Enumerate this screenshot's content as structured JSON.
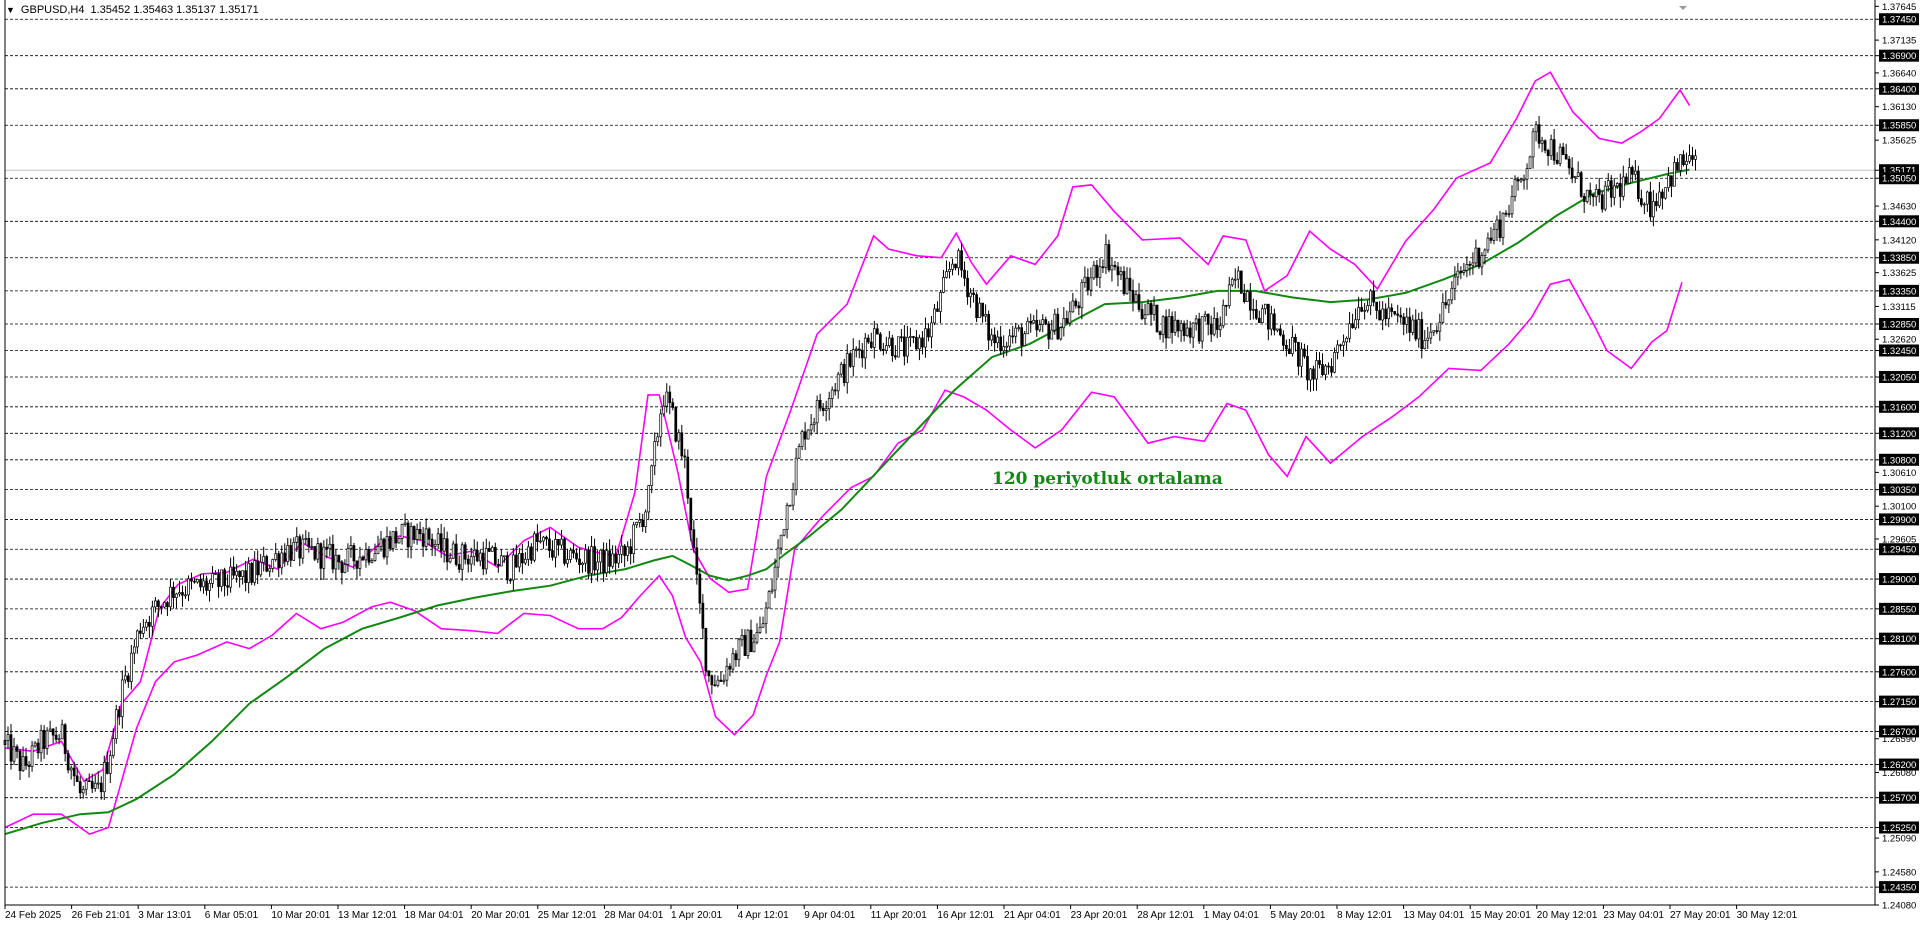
{
  "header": {
    "symbol_timeframe": "GBPUSD,H4",
    "ohlc": "1.35452 1.35463 1.35137 1.35171"
  },
  "colors": {
    "candles": "#000000",
    "bollinger": "#ff00ff",
    "moving_average": "#118811",
    "grid": "#000000",
    "current_price_line": "#c0c0c0"
  },
  "annotation": {
    "text": "120 periyotluk ortalama"
  },
  "chart_data": {
    "type": "candlestick",
    "title": "GBPUSD,H4",
    "ylim": [
      1.2408,
      1.3768
    ],
    "current_price": 1.35171,
    "y_ticks": [
      "1.37645",
      "1.37450",
      "1.37135",
      "1.36900",
      "1.36640",
      "1.36400",
      "1.36130",
      "1.35850",
      "1.35625",
      "1.35171",
      "1.35050",
      "1.34630",
      "1.34400",
      "1.34120",
      "1.33850",
      "1.33625",
      "1.33350",
      "1.33115",
      "1.32850",
      "1.32620",
      "1.32450",
      "1.32050",
      "1.31600",
      "1.31200",
      "1.30800",
      "1.30610",
      "1.30350",
      "1.30100",
      "1.29900",
      "1.29605",
      "1.29450",
      "1.29000",
      "1.28550",
      "1.28100",
      "1.27600",
      "1.27150",
      "1.26700",
      "1.26590",
      "1.26200",
      "1.26080",
      "1.25700",
      "1.25250",
      "1.25090",
      "1.24580",
      "1.24350",
      "1.24080"
    ],
    "highlighted_levels": [
      1.3745,
      1.369,
      1.364,
      1.3585,
      1.3505,
      1.344,
      1.3385,
      1.3335,
      1.3285,
      1.3245,
      1.3205,
      1.316,
      1.312,
      1.308,
      1.3035,
      1.299,
      1.2945,
      1.29,
      1.2855,
      1.281,
      1.276,
      1.2715,
      1.267,
      1.262,
      1.257,
      1.2525,
      1.2435
    ],
    "x_labels": [
      "24 Feb 2025",
      "26 Feb 21:01",
      "3 Mar 13:01",
      "6 Mar 05:01",
      "10 Mar 20:01",
      "13 Mar 12:01",
      "18 Mar 04:01",
      "20 Mar 20:01",
      "25 Mar 12:01",
      "28 Mar 04:01",
      "1 Apr 20:01",
      "4 Apr 12:01",
      "9 Apr 04:01",
      "11 Apr 20:01",
      "16 Apr 12:01",
      "21 Apr 04:01",
      "23 Apr 20:01",
      "28 Apr 12:01",
      "1 May 04:01",
      "5 May 20:01",
      "8 May 12:01",
      "13 May 04:01",
      "15 May 20:01",
      "20 May 12:01",
      "23 May 04:01",
      "27 May 20:01",
      "30 May 12:01"
    ],
    "close_path": [
      [
        0,
        1.265
      ],
      [
        10,
        1.2615
      ],
      [
        20,
        1.2655
      ],
      [
        30,
        1.2665
      ],
      [
        40,
        1.2575
      ],
      [
        50,
        1.258
      ],
      [
        55,
        1.263
      ],
      [
        62,
        1.273
      ],
      [
        72,
        1.283
      ],
      [
        90,
        1.2885
      ],
      [
        110,
        1.289
      ],
      [
        130,
        1.2905
      ],
      [
        150,
        1.2945
      ],
      [
        165,
        1.294
      ],
      [
        180,
        1.2925
      ],
      [
        195,
        1.2945
      ],
      [
        210,
        1.2965
      ],
      [
        222,
        1.297
      ],
      [
        232,
        1.2945
      ],
      [
        242,
        1.2935
      ],
      [
        255,
        1.2935
      ],
      [
        270,
        1.2915
      ],
      [
        282,
        1.2955
      ],
      [
        300,
        1.2935
      ],
      [
        318,
        1.2925
      ],
      [
        330,
        1.2935
      ],
      [
        342,
        1.3015
      ],
      [
        350,
        1.318
      ],
      [
        355,
        1.3145
      ],
      [
        362,
        1.307
      ],
      [
        368,
        1.289
      ],
      [
        374,
        1.2755
      ],
      [
        380,
        1.2745
      ],
      [
        386,
        1.278
      ],
      [
        395,
        1.2805
      ],
      [
        402,
        1.282
      ],
      [
        408,
        1.289
      ],
      [
        415,
        1.3
      ],
      [
        425,
        1.3125
      ],
      [
        440,
        1.319
      ],
      [
        460,
        1.327
      ],
      [
        480,
        1.3245
      ],
      [
        492,
        1.3275
      ],
      [
        498,
        1.3325
      ],
      [
        505,
        1.339
      ],
      [
        515,
        1.3325
      ],
      [
        525,
        1.326
      ],
      [
        535,
        1.3265
      ],
      [
        550,
        1.3275
      ],
      [
        562,
        1.3285
      ],
      [
        570,
        1.3315
      ],
      [
        578,
        1.3355
      ],
      [
        585,
        1.3395
      ],
      [
        595,
        1.3345
      ],
      [
        605,
        1.331
      ],
      [
        615,
        1.3285
      ],
      [
        630,
        1.328
      ],
      [
        645,
        1.328
      ],
      [
        655,
        1.3355
      ],
      [
        665,
        1.3315
      ],
      [
        675,
        1.328
      ],
      [
        685,
        1.325
      ],
      [
        695,
        1.3205
      ],
      [
        705,
        1.3225
      ],
      [
        715,
        1.3285
      ],
      [
        722,
        1.3325
      ],
      [
        732,
        1.33
      ],
      [
        745,
        1.3285
      ],
      [
        755,
        1.3265
      ],
      [
        765,
        1.3305
      ],
      [
        775,
        1.3365
      ],
      [
        785,
        1.3395
      ],
      [
        795,
        1.3435
      ],
      [
        805,
        1.3495
      ],
      [
        815,
        1.3575
      ],
      [
        825,
        1.3545
      ],
      [
        835,
        1.3505
      ],
      [
        845,
        1.3465
      ],
      [
        855,
        1.3485
      ],
      [
        865,
        1.3505
      ],
      [
        875,
        1.3465
      ],
      [
        885,
        1.3505
      ],
      [
        895,
        1.3537
      ],
      [
        900,
        1.3517
      ]
    ],
    "series": [
      {
        "name": "BB upper",
        "color": "#ff00ff",
        "points": [
          [
            0,
            1.2645
          ],
          [
            15,
            1.264
          ],
          [
            30,
            1.2655
          ],
          [
            42,
            1.2595
          ],
          [
            52,
            1.2612
          ],
          [
            62,
            1.2712
          ],
          [
            72,
            1.2745
          ],
          [
            82,
            1.2855
          ],
          [
            92,
            1.2892
          ],
          [
            105,
            1.2908
          ],
          [
            118,
            1.291
          ],
          [
            132,
            1.293
          ],
          [
            145,
            1.2915
          ],
          [
            158,
            1.2955
          ],
          [
            170,
            1.2935
          ],
          [
            185,
            1.2918
          ],
          [
            200,
            1.2955
          ],
          [
            210,
            1.2965
          ],
          [
            222,
            1.2958
          ],
          [
            235,
            1.2935
          ],
          [
            248,
            1.2942
          ],
          [
            262,
            1.2918
          ],
          [
            276,
            1.2958
          ],
          [
            290,
            1.2978
          ],
          [
            305,
            1.2948
          ],
          [
            318,
            1.2938
          ],
          [
            325,
            1.2935
          ],
          [
            335,
            1.303
          ],
          [
            342,
            1.3178
          ],
          [
            348,
            1.3178
          ],
          [
            352,
            1.3132
          ],
          [
            358,
            1.306
          ],
          [
            366,
            1.2945
          ],
          [
            375,
            1.2901
          ],
          [
            385,
            1.288
          ],
          [
            395,
            1.2885
          ],
          [
            405,
            1.3055
          ],
          [
            418,
            1.3155
          ],
          [
            432,
            1.327
          ],
          [
            448,
            1.3315
          ],
          [
            462,
            1.3418
          ],
          [
            470,
            1.3398
          ],
          [
            485,
            1.3388
          ],
          [
            498,
            1.3385
          ],
          [
            506,
            1.3422
          ],
          [
            514,
            1.3378
          ],
          [
            522,
            1.3345
          ],
          [
            535,
            1.3388
          ],
          [
            548,
            1.3375
          ],
          [
            560,
            1.3418
          ],
          [
            568,
            1.3492
          ],
          [
            578,
            1.3495
          ],
          [
            590,
            1.3455
          ],
          [
            605,
            1.3412
          ],
          [
            625,
            1.3415
          ],
          [
            640,
            1.3375
          ],
          [
            648,
            1.3418
          ],
          [
            660,
            1.3412
          ],
          [
            670,
            1.3335
          ],
          [
            682,
            1.3358
          ],
          [
            694,
            1.3425
          ],
          [
            705,
            1.3398
          ],
          [
            718,
            1.3375
          ],
          [
            730,
            1.3338
          ],
          [
            745,
            1.341
          ],
          [
            760,
            1.3458
          ],
          [
            772,
            1.3505
          ],
          [
            790,
            1.3528
          ],
          [
            804,
            1.3595
          ],
          [
            814,
            1.3652
          ],
          [
            822,
            1.3665
          ],
          [
            834,
            1.3605
          ],
          [
            848,
            1.3565
          ],
          [
            860,
            1.3558
          ],
          [
            870,
            1.3575
          ],
          [
            880,
            1.3595
          ],
          [
            891,
            1.3638
          ],
          [
            896,
            1.3615
          ]
        ]
      },
      {
        "name": "BB lower",
        "color": "#ff00ff",
        "points": [
          [
            0,
            1.2525
          ],
          [
            15,
            1.2545
          ],
          [
            30,
            1.2545
          ],
          [
            45,
            1.2515
          ],
          [
            55,
            1.2525
          ],
          [
            62,
            1.2595
          ],
          [
            70,
            1.2675
          ],
          [
            80,
            1.2745
          ],
          [
            90,
            1.2775
          ],
          [
            102,
            1.2785
          ],
          [
            118,
            1.2805
          ],
          [
            130,
            1.2795
          ],
          [
            142,
            1.2815
          ],
          [
            155,
            1.2848
          ],
          [
            168,
            1.2825
          ],
          [
            180,
            1.2835
          ],
          [
            195,
            1.2858
          ],
          [
            205,
            1.2865
          ],
          [
            218,
            1.2852
          ],
          [
            232,
            1.2825
          ],
          [
            248,
            1.2822
          ],
          [
            262,
            1.2818
          ],
          [
            276,
            1.2848
          ],
          [
            290,
            1.2845
          ],
          [
            305,
            1.2825
          ],
          [
            318,
            1.2825
          ],
          [
            328,
            1.2842
          ],
          [
            338,
            1.2875
          ],
          [
            348,
            1.2905
          ],
          [
            355,
            1.2875
          ],
          [
            362,
            1.2812
          ],
          [
            370,
            1.2775
          ],
          [
            378,
            1.2692
          ],
          [
            388,
            1.2665
          ],
          [
            398,
            1.2695
          ],
          [
            405,
            1.2755
          ],
          [
            412,
            1.2805
          ],
          [
            420,
            1.2945
          ],
          [
            435,
            1.2995
          ],
          [
            450,
            1.3038
          ],
          [
            462,
            1.3055
          ],
          [
            475,
            1.3105
          ],
          [
            488,
            1.3125
          ],
          [
            500,
            1.3185
          ],
          [
            510,
            1.3175
          ],
          [
            522,
            1.3155
          ],
          [
            535,
            1.3125
          ],
          [
            548,
            1.3098
          ],
          [
            562,
            1.3125
          ],
          [
            578,
            1.3182
          ],
          [
            590,
            1.3175
          ],
          [
            608,
            1.3105
          ],
          [
            622,
            1.3115
          ],
          [
            638,
            1.3108
          ],
          [
            650,
            1.3165
          ],
          [
            660,
            1.3155
          ],
          [
            672,
            1.3088
          ],
          [
            682,
            1.3055
          ],
          [
            692,
            1.3115
          ],
          [
            705,
            1.3075
          ],
          [
            722,
            1.3115
          ],
          [
            738,
            1.3145
          ],
          [
            752,
            1.3175
          ],
          [
            768,
            1.3218
          ],
          [
            785,
            1.3215
          ],
          [
            800,
            1.3255
          ],
          [
            812,
            1.3295
          ],
          [
            822,
            1.3345
          ],
          [
            832,
            1.3352
          ],
          [
            845,
            1.3285
          ],
          [
            852,
            1.3245
          ],
          [
            865,
            1.3218
          ],
          [
            876,
            1.3258
          ],
          [
            884,
            1.3275
          ],
          [
            892,
            1.3348
          ]
        ]
      },
      {
        "name": "MA 120",
        "color": "#118811",
        "points": [
          [
            0,
            1.2515
          ],
          [
            20,
            1.2532
          ],
          [
            40,
            1.2545
          ],
          [
            55,
            1.2548
          ],
          [
            70,
            1.2568
          ],
          [
            90,
            1.2605
          ],
          [
            110,
            1.2655
          ],
          [
            130,
            1.2712
          ],
          [
            150,
            1.2752
          ],
          [
            170,
            1.2795
          ],
          [
            190,
            1.2825
          ],
          [
            210,
            1.2842
          ],
          [
            230,
            1.286
          ],
          [
            250,
            1.2872
          ],
          [
            270,
            1.2882
          ],
          [
            290,
            1.289
          ],
          [
            310,
            1.2905
          ],
          [
            330,
            1.2915
          ],
          [
            345,
            1.2928
          ],
          [
            355,
            1.2935
          ],
          [
            362,
            1.2925
          ],
          [
            375,
            1.2905
          ],
          [
            385,
            1.2898
          ],
          [
            395,
            1.2905
          ],
          [
            405,
            1.2915
          ],
          [
            415,
            1.2938
          ],
          [
            428,
            1.2965
          ],
          [
            445,
            1.3005
          ],
          [
            465,
            1.3065
          ],
          [
            485,
            1.3125
          ],
          [
            505,
            1.3185
          ],
          [
            525,
            1.3235
          ],
          [
            545,
            1.3255
          ],
          [
            565,
            1.3285
          ],
          [
            585,
            1.3315
          ],
          [
            605,
            1.3318
          ],
          [
            625,
            1.3325
          ],
          [
            645,
            1.3335
          ],
          [
            665,
            1.3335
          ],
          [
            685,
            1.3325
          ],
          [
            705,
            1.3318
          ],
          [
            725,
            1.3322
          ],
          [
            745,
            1.3332
          ],
          [
            765,
            1.3352
          ],
          [
            785,
            1.3375
          ],
          [
            805,
            1.3408
          ],
          [
            825,
            1.3448
          ],
          [
            845,
            1.3482
          ],
          [
            865,
            1.3498
          ],
          [
            885,
            1.3512
          ],
          [
            896,
            1.3518
          ]
        ]
      }
    ]
  }
}
